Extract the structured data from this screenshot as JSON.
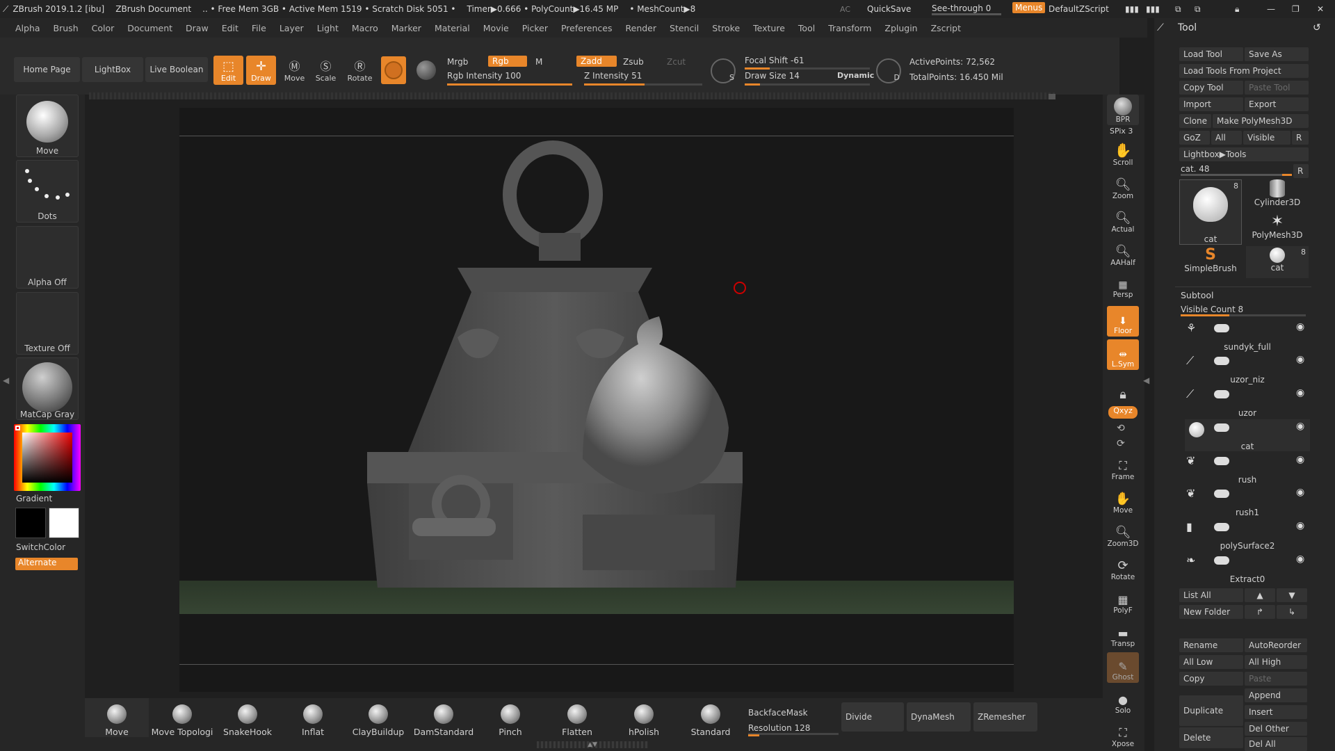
{
  "titlebar": {
    "app": "ZBrush 2019.1.2 [ibu]",
    "doc": "ZBrush Document",
    "mem": ".. • Free Mem 3GB • Active Mem 1519 • Scratch Disk 5051 •",
    "timer": "Timer▶0.666 • PolyCount▶16.45 MP",
    "mesh": "• MeshCount▶8",
    "ac": "AC",
    "quicksave": "QuickSave",
    "seethrough": "See-through  0",
    "menus": "Menus",
    "script": "DefaultZScript"
  },
  "menu": [
    "Alpha",
    "Brush",
    "Color",
    "Document",
    "Draw",
    "Edit",
    "File",
    "Layer",
    "Light",
    "Macro",
    "Marker",
    "Material",
    "Movie",
    "Picker",
    "Preferences",
    "Render",
    "Stencil",
    "Stroke",
    "Texture",
    "Tool",
    "Transform",
    "Zplugin",
    "Zscript"
  ],
  "toolbar": {
    "home": "Home Page",
    "lightbox": "LightBox",
    "liveboolean": "Live Boolean",
    "edit": "Edit",
    "draw": "Draw",
    "move": "Move",
    "scale": "Scale",
    "rotate": "Rotate",
    "mrgb": "Mrgb",
    "rgb": "Rgb",
    "m": "M",
    "zadd": "Zadd",
    "zsub": "Zsub",
    "zcut": "Zcut",
    "rgbintensity": "Rgb Intensity 100",
    "zintensity": "Z Intensity 51",
    "focal": "Focal Shift -61",
    "drawsize": "Draw Size 14",
    "dynamic": "Dynamic",
    "activepoints": "ActivePoints: 72,562",
    "totalpoints": "TotalPoints: 16.450 Mil",
    "rgb_intensity_value": 100,
    "z_intensity_value": 51
  },
  "left": {
    "brush": "Move",
    "stroke": "Dots",
    "alpha": "Alpha Off",
    "texture": "Texture Off",
    "material": "MatCap Gray",
    "gradient": "Gradient",
    "switchcolor": "SwitchColor",
    "alternate": "Alternate"
  },
  "right": [
    "BPR",
    "SPix 3",
    "Scroll",
    "Zoom",
    "Actual",
    "AAHalf",
    "Persp",
    "Floor",
    "L.Sym",
    "",
    "Qxyz",
    "",
    "",
    "Frame",
    "Move",
    "Zoom3D",
    "Rotate",
    "PolyF",
    "Transp",
    "Ghost",
    "Solo",
    "Xpose"
  ],
  "tool": {
    "title": "Tool",
    "load": "Load Tool",
    "saveas": "Save As",
    "loadproj": "Load Tools From Project",
    "copy": "Copy Tool",
    "paste": "Paste Tool",
    "import": "Import",
    "export": "Export",
    "clone": "Clone",
    "makepoly": "Make PolyMesh3D",
    "goz": "GoZ",
    "all": "All",
    "visible": "Visible",
    "r": "R",
    "lightbox": "Lightbox▶Tools",
    "cat": "cat. 48",
    "thumbs": [
      "cat",
      "Cylinder3D",
      "PolyMesh3D",
      "SimpleBrush",
      "cat"
    ],
    "badge": "8"
  },
  "subtool": {
    "title": "Subtool",
    "count": "Visible Count 8",
    "items": [
      "sundyk_full",
      "uzor_niz",
      "uzor",
      "cat",
      "rush",
      "rush1",
      "polySurface2",
      "Extract0"
    ],
    "listall": "List All",
    "newfolder": "New Folder",
    "rename": "Rename",
    "autoreorder": "AutoReorder",
    "alllow": "All Low",
    "allhigh": "All High",
    "copy": "Copy",
    "paste": "Paste",
    "append": "Append",
    "duplicate": "Duplicate",
    "insert": "Insert",
    "delete": "Delete",
    "delother": "Del Other",
    "delall": "Del All"
  },
  "bottom": {
    "brushes": [
      "Move",
      "Move Topologi",
      "SnakeHook",
      "Inflat",
      "ClayBuildup",
      "DamStandard",
      "Pinch",
      "Flatten",
      "hPolish",
      "Standard"
    ],
    "backface": "BackfaceMask",
    "resolution": "Resolution 128",
    "divide": "Divide",
    "dynamesh": "DynaMesh",
    "zremesher": "ZRemesher"
  },
  "colors": {
    "accent": "#e8862a",
    "bg": "#262626"
  }
}
